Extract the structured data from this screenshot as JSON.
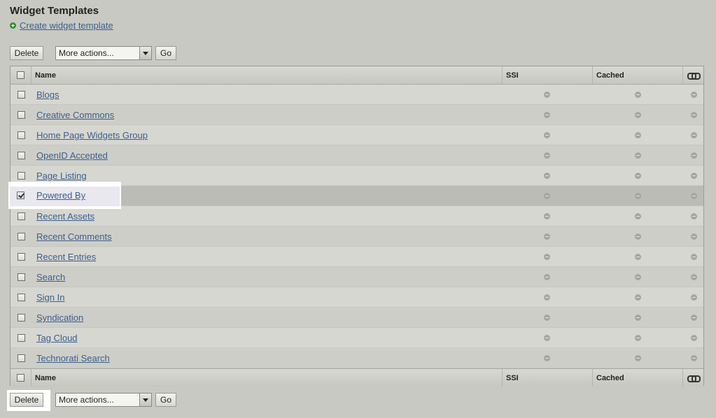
{
  "page": {
    "title": "Widget Templates",
    "create_link": "Create widget template"
  },
  "actions": {
    "delete_label": "Delete",
    "select_value": "More actions...",
    "go_label": "Go"
  },
  "table": {
    "columns": {
      "name": "Name",
      "ssi": "SSI",
      "cached": "Cached"
    },
    "rows": [
      {
        "name": "Blogs",
        "checked": false
      },
      {
        "name": "Creative Commons",
        "checked": false
      },
      {
        "name": "Home Page Widgets Group",
        "checked": false
      },
      {
        "name": "OpenID Accepted",
        "checked": false
      },
      {
        "name": "Page Listing",
        "checked": false
      },
      {
        "name": "Powered By",
        "checked": true
      },
      {
        "name": "Recent Assets",
        "checked": false
      },
      {
        "name": "Recent Comments",
        "checked": false
      },
      {
        "name": "Recent Entries",
        "checked": false
      },
      {
        "name": "Search",
        "checked": false
      },
      {
        "name": "Sign In",
        "checked": false
      },
      {
        "name": "Syndication",
        "checked": false
      },
      {
        "name": "Tag Cloud",
        "checked": false
      },
      {
        "name": "Technorati Search",
        "checked": false
      }
    ]
  },
  "icons": {
    "create": "plus-icon",
    "status": "disabled-dash-icon",
    "link_column": "chain-link-icon"
  },
  "colors": {
    "link": "#3a5f8c",
    "background": "#c9c9c3",
    "create_icon": "#2f8a2f"
  }
}
